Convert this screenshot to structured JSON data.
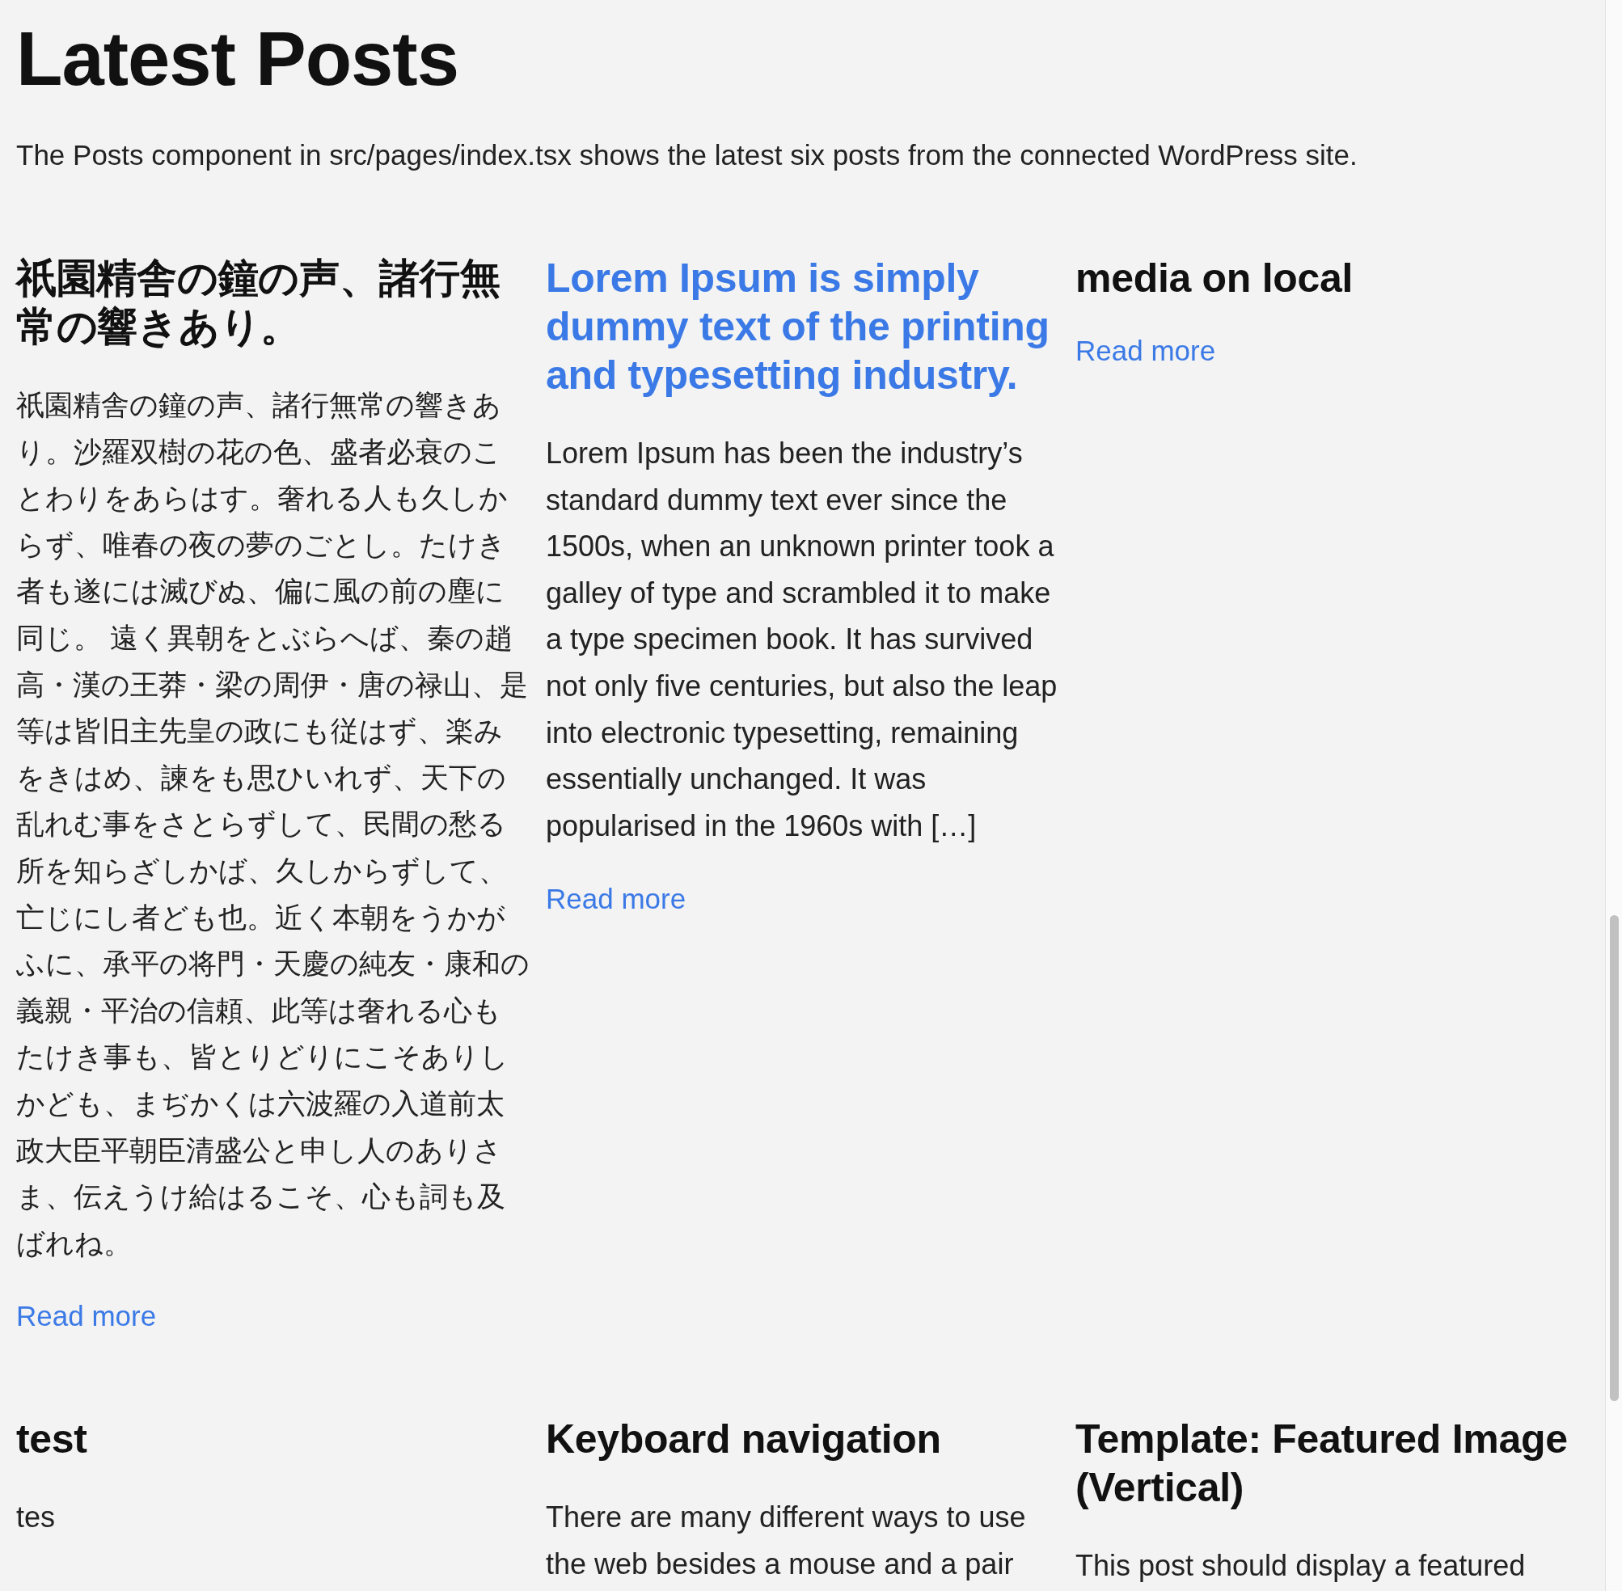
{
  "heading": "Latest Posts",
  "intro": "The Posts component in src/pages/index.tsx shows the latest six posts from the connected WordPress site.",
  "posts": [
    {
      "title": "祇園精舎の鐘の声、諸行無常の響きあり。",
      "hovered": false,
      "excerpt": "祇園精舎の鐘の声、諸行無常の響きあり。沙羅双樹の花の色、盛者必衰のことわりをあらはす。奢れる人も久しからず、唯春の夜の夢のごとし。たけき者も遂には滅びぬ、偏に風の前の塵に同じ。 遠く異朝をとぶらへば、秦の趙高・漢の王莽・梁の周伊・唐の禄山、是等は皆旧主先皇の政にも従はず、楽みをきはめ、諫をも思ひいれず、天下の乱れむ事をさとらずして、民間の愁る所を知らざしかば、久しからずして、亡じにし者ども也。近く本朝をうかがふに、承平の将門・天慶の純友・康和の義親・平治の信頼、此等は奢れる心もたけき事も、皆とりどりにこそありしかども、まぢかくは六波羅の入道前太政大臣平朝臣清盛公と申し人のありさま、伝えうけ給はるこそ、心も詞も及ばれね。",
      "read_more": "Read more"
    },
    {
      "title": "Lorem Ipsum is simply dummy text of the printing and typesetting industry.",
      "hovered": true,
      "excerpt": "Lorem Ipsum has been the industry’s standard dummy text ever since the 1500s, when an unknown printer took a galley of type and scrambled it to make a type specimen book. It has survived not only five centuries, but also the leap into electronic typesetting, remaining essentially unchanged. It was popularised in the 1960s with […]",
      "read_more": "Read more"
    },
    {
      "title": "media on local",
      "hovered": false,
      "read_more": "Read more"
    },
    {
      "title": "test",
      "hovered": false,
      "excerpt": "tes"
    },
    {
      "title": "Keyboard navigation",
      "hovered": false,
      "excerpt": "There are many different ways to use the web besides a mouse and a pair"
    },
    {
      "title": "Template: Featured Image (Vertical)",
      "hovered": false,
      "excerpt": "This post should display a featured"
    }
  ]
}
